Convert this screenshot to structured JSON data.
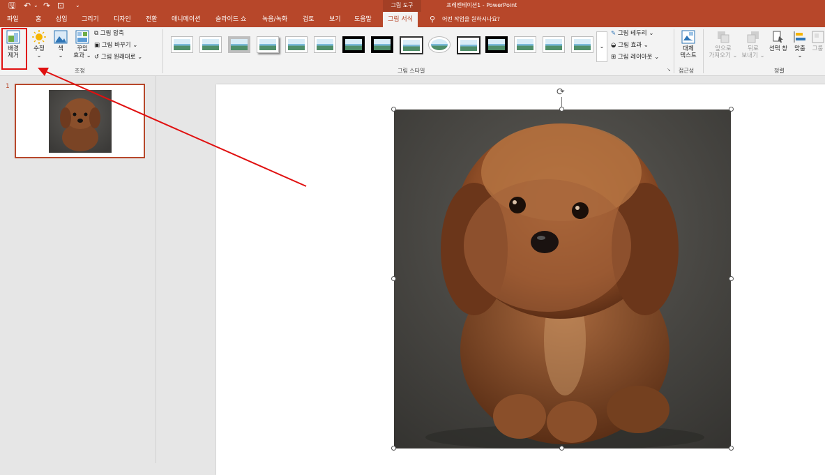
{
  "app": {
    "title": "프레젠테이션1 - PowerPoint",
    "context_tab_label": "그림 도구"
  },
  "tabs": [
    "파일",
    "홈",
    "삽입",
    "그리기",
    "디자인",
    "전환",
    "애니메이션",
    "슬라이드 쇼",
    "녹음/녹화",
    "검토",
    "보기",
    "도움말",
    "그림 서식"
  ],
  "active_tab": "그림 서식",
  "tell_me": "어떤 작업을 원하시나요?",
  "ribbon": {
    "adjust": {
      "remove_bg_line1": "배경",
      "remove_bg_line2": "제거",
      "corrections": "수정",
      "color": "색",
      "artistic_line1": "꾸밈",
      "artistic_line2": "효과",
      "compress": "그림 압축",
      "change": "그림 바꾸기",
      "reset": "그림 원래대로",
      "group_label": "조정"
    },
    "styles": {
      "group_label": "그림 스타일",
      "border": "그림 테두리",
      "effects": "그림 효과",
      "layout": "그림 레이아웃"
    },
    "accessibility": {
      "alt_line1": "대체",
      "alt_line2": "텍스트",
      "group_label": "접근성"
    },
    "arrange": {
      "forward_line1": "앞으로",
      "forward_line2": "가져오기",
      "backward_line1": "뒤로",
      "backward_line2": "보내기",
      "selection_pane": "선택 창",
      "align": "맞춤",
      "group": "그룹",
      "group_label": "정렬"
    }
  },
  "slides": {
    "number": "1"
  },
  "colors": {
    "accent": "#b7472a",
    "highlight": "#e01010"
  }
}
